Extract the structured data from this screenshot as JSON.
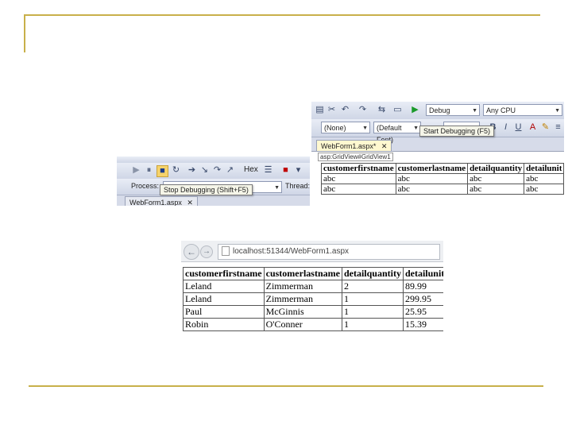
{
  "vs_right": {
    "toolbar1": {
      "config_combo": "Debug",
      "platform_combo": "Any CPU"
    },
    "toolbar2": {
      "style_combo": "(None)",
      "font_combo": "(Default Font)",
      "bold_label": "B",
      "italic_label": "I",
      "underline_label": "U",
      "font_color_label": "A"
    },
    "start_tooltip": "Start Debugging (F5)",
    "doc_tab": "WebForm1.aspx*",
    "tag_path": "asp:GridView#GridView1",
    "grid_headers": [
      "customerfirstname",
      "customerlastname",
      "detailquantity",
      "detailunit"
    ],
    "grid_rows": [
      [
        "abc",
        "abc",
        "abc",
        "abc"
      ],
      [
        "abc",
        "abc",
        "abc",
        "abc"
      ]
    ]
  },
  "vs_left": {
    "hex_label": "Hex",
    "process_label": "Process:",
    "thread_label": "Thread:",
    "stop_tooltip": "Stop Debugging (Shift+F5)",
    "doc_tab": "WebForm1.aspx"
  },
  "browser": {
    "url": "localhost:51344/WebForm1.aspx",
    "headers": [
      "customerfirstname",
      "customerlastname",
      "detailquantity",
      "detailunitp"
    ],
    "rows": [
      [
        "Leland",
        "Zimmerman",
        "2",
        "89.99"
      ],
      [
        "Leland",
        "Zimmerman",
        "1",
        "299.95"
      ],
      [
        "Paul",
        "McGinnis",
        "1",
        "25.95"
      ],
      [
        "Robin",
        "O'Conner",
        "1",
        "15.39"
      ]
    ]
  }
}
